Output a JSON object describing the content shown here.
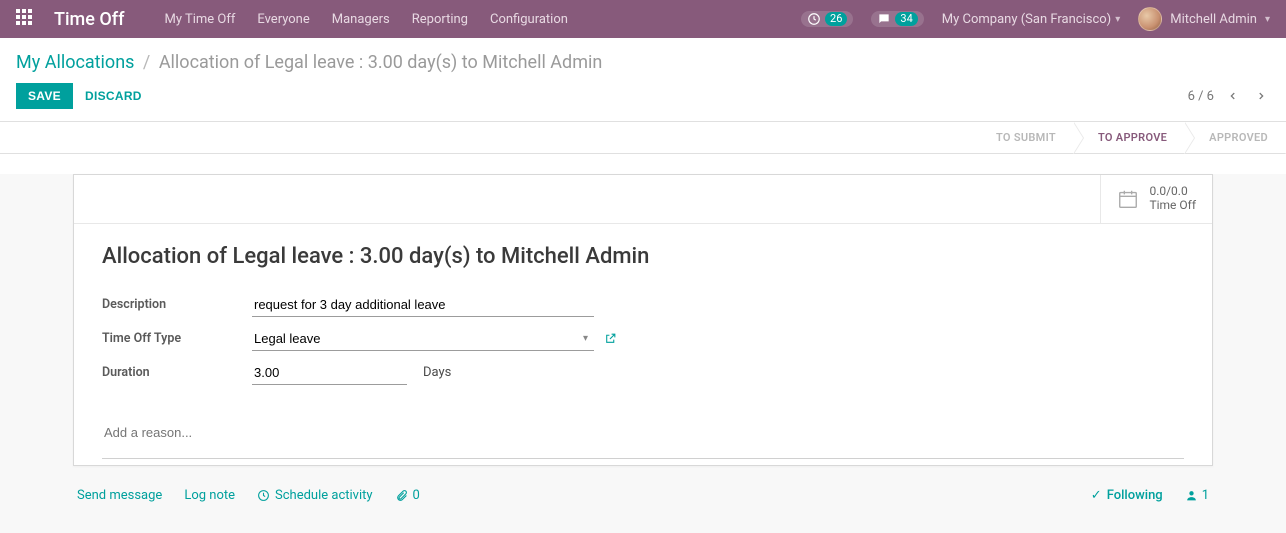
{
  "topbar": {
    "app_title": "Time Off",
    "menu": [
      "My Time Off",
      "Everyone",
      "Managers",
      "Reporting",
      "Configuration"
    ],
    "activities_count": "26",
    "messages_count": "34",
    "company": "My Company (San Francisco)",
    "user_name": "Mitchell Admin"
  },
  "breadcrumbs": {
    "parent": "My Allocations",
    "current": "Allocation of Legal leave : 3.00 day(s) to Mitchell Admin"
  },
  "actions": {
    "save": "SAVE",
    "discard": "DISCARD"
  },
  "pager": {
    "position": "6 / 6"
  },
  "status": {
    "steps": [
      "TO SUBMIT",
      "TO APPROVE",
      "APPROVED"
    ],
    "active_index": 1
  },
  "stat": {
    "value": "0.0/0.0",
    "label": "Time Off"
  },
  "record": {
    "title": "Allocation of Legal leave : 3.00 day(s) to Mitchell Admin",
    "labels": {
      "description": "Description",
      "type": "Time Off Type",
      "duration": "Duration"
    },
    "description": "request for 3 day additional leave",
    "type": "Legal leave",
    "duration": "3.00",
    "duration_unit": "Days",
    "reason_placeholder": "Add a reason..."
  },
  "chatter": {
    "send": "Send message",
    "log": "Log note",
    "schedule": "Schedule activity",
    "attach_count": "0",
    "following": "Following",
    "follower_count": "1"
  }
}
